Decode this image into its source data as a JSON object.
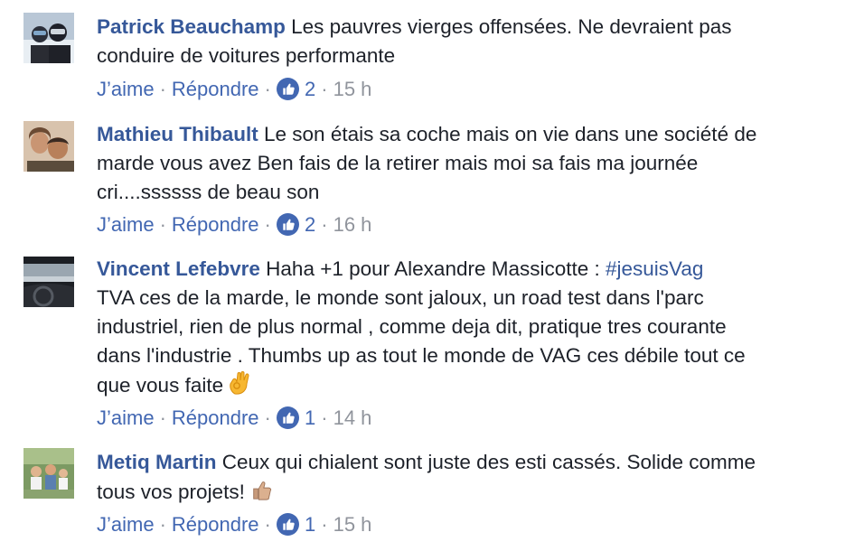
{
  "actions": {
    "like_label": "J’aime",
    "reply_label": "Répondre",
    "separator": "·"
  },
  "comments": [
    {
      "author": "Patrick Beauchamp",
      "lines": [
        "Les pauvres vierges offensées. Ne devraient pas",
        "conduire de voitures performante"
      ],
      "reactions": "2",
      "time": "15 h"
    },
    {
      "author": "Mathieu Thibault",
      "lines": [
        "Le son étais sa coche mais on vie dans une société de",
        "marde vous avez Ben fais de la retirer mais moi sa fais ma journée",
        "cri....ssssss de beau son"
      ],
      "reactions": "2",
      "time": "16 h"
    },
    {
      "author": "Vincent Lefebvre",
      "first_line_text": "Haha +1 pour Alexandre Massicotte : ",
      "hashtag": "#jesuisVag",
      "lines": [
        "TVA ces de la marde, le monde sont jaloux, un road test dans l'parc",
        "industriel, rien de plus normal , comme deja dit, pratique tres courante",
        "dans l'industrie . Thumbs up as tout le monde de VAG ces débile tout ce",
        "que vous faite"
      ],
      "emoji": "ok-hand-emoji",
      "reactions": "1",
      "time": "14 h"
    },
    {
      "author": "Metiq Martin",
      "lines": [
        "Ceux qui chialent sont juste des esti cassés. Solide comme",
        "tous vos projets!"
      ],
      "emoji": "thumbs-up-emoji",
      "reactions": "1",
      "time": "15 h"
    }
  ],
  "colors": {
    "name_link": "#365899",
    "action_link": "#4267b2",
    "muted": "#90949c",
    "like_blue": "#4267b2"
  }
}
